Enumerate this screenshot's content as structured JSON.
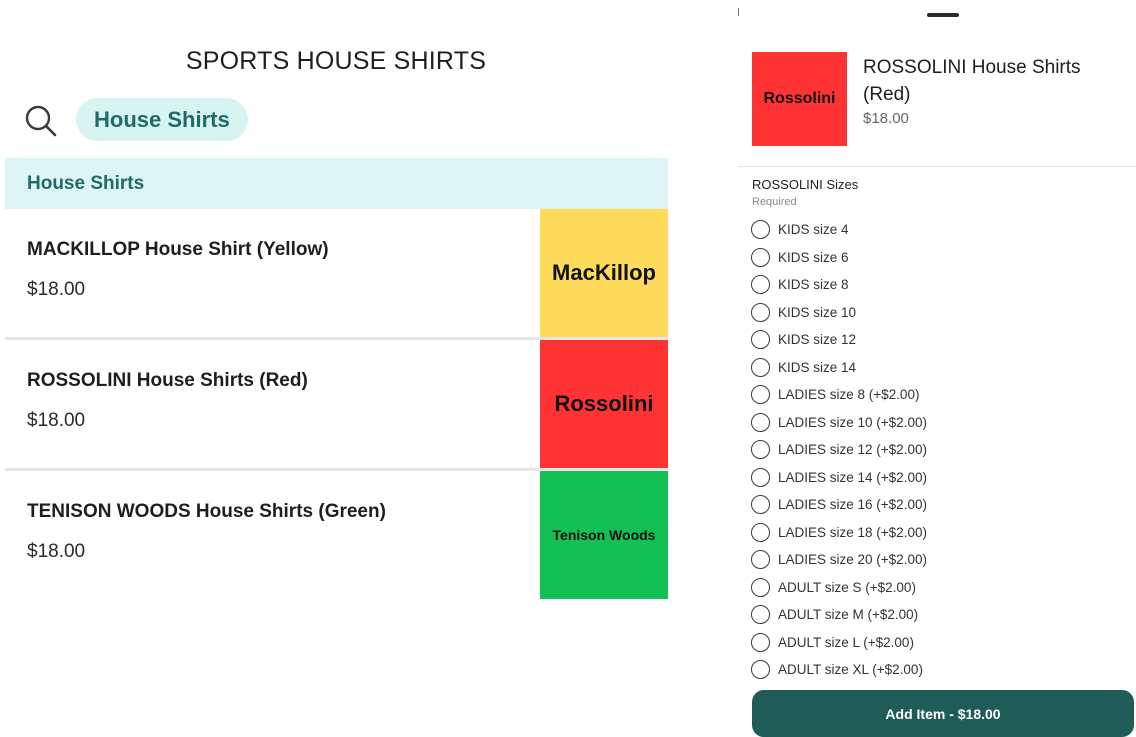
{
  "left": {
    "title": "SPORTS HOUSE SHIRTS",
    "search_chip": "House Shirts",
    "section_title": "House Shirts",
    "products": [
      {
        "name": "MACKILLOP House Shirt (Yellow)",
        "price": "$18.00",
        "thumb_text": "MacKillop",
        "thumb_color": "#ffdb5c"
      },
      {
        "name": "ROSSOLINI House Shirts (Red)",
        "price": "$18.00",
        "thumb_text": "Rossolini",
        "thumb_color": "#ff3333"
      },
      {
        "name": "TENISON WOODS House Shirts (Green)",
        "price": "$18.00",
        "thumb_text": "Tenison Woods",
        "thumb_color": "#14c055"
      }
    ]
  },
  "detail": {
    "thumb_text": "Rossolini",
    "thumb_color": "#ff3333",
    "name": "ROSSOLINI House Shirts (Red)",
    "price": "$18.00",
    "options_title": "ROSSOLINI Sizes",
    "required_label": "Required",
    "options": [
      "KIDS size 4",
      "KIDS size 6",
      "KIDS size 8",
      "KIDS size 10",
      "KIDS size 12",
      "KIDS size 14",
      "LADIES size 8 (+$2.00)",
      "LADIES size 10 (+$2.00)",
      "LADIES size 12 (+$2.00)",
      "LADIES size 14 (+$2.00)",
      "LADIES size 16 (+$2.00)",
      "LADIES size 18 (+$2.00)",
      "LADIES size 20 (+$2.00)",
      "ADULT size S (+$2.00)",
      "ADULT size M (+$2.00)",
      "ADULT size L (+$2.00)",
      "ADULT size XL (+$2.00)"
    ],
    "add_button": "Add Item - $18.00"
  },
  "colors": {
    "accent_dark": "#1f5c57",
    "chip_bg": "#d7f3f2",
    "section_bg": "#def4f5"
  }
}
